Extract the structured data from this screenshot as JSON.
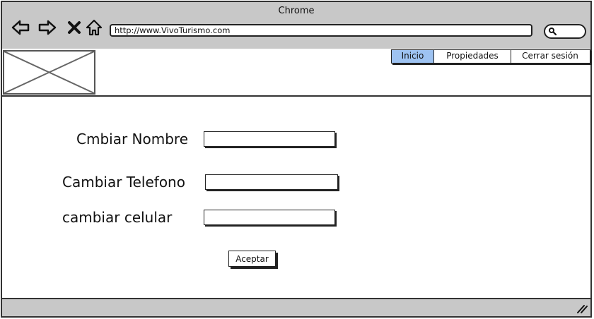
{
  "window": {
    "title": "Chrome",
    "url": "http://www.VivoTurismo.com"
  },
  "icons": {
    "back": "arrow-left-icon",
    "forward": "arrow-right-icon",
    "stop": "close-icon",
    "home": "home-icon",
    "search": "search-icon",
    "logo": "image-placeholder-icon",
    "resize": "resize-grip-icon"
  },
  "nav": {
    "tabs": [
      {
        "label": "Inicio",
        "active": true
      },
      {
        "label": "Propiedades",
        "active": false
      },
      {
        "label": "Cerrar sesión",
        "active": false
      }
    ]
  },
  "form": {
    "name_label": "Cmbiar Nombre",
    "name_value": "",
    "phone_label": "Cambiar Telefono",
    "phone_value": "",
    "cell_label": "cambiar celular",
    "cell_value": "",
    "submit_label": "Aceptar"
  },
  "colors": {
    "chrome": "#c8c8c8",
    "active_tab": "#9ec3f2",
    "border": "#333333"
  }
}
